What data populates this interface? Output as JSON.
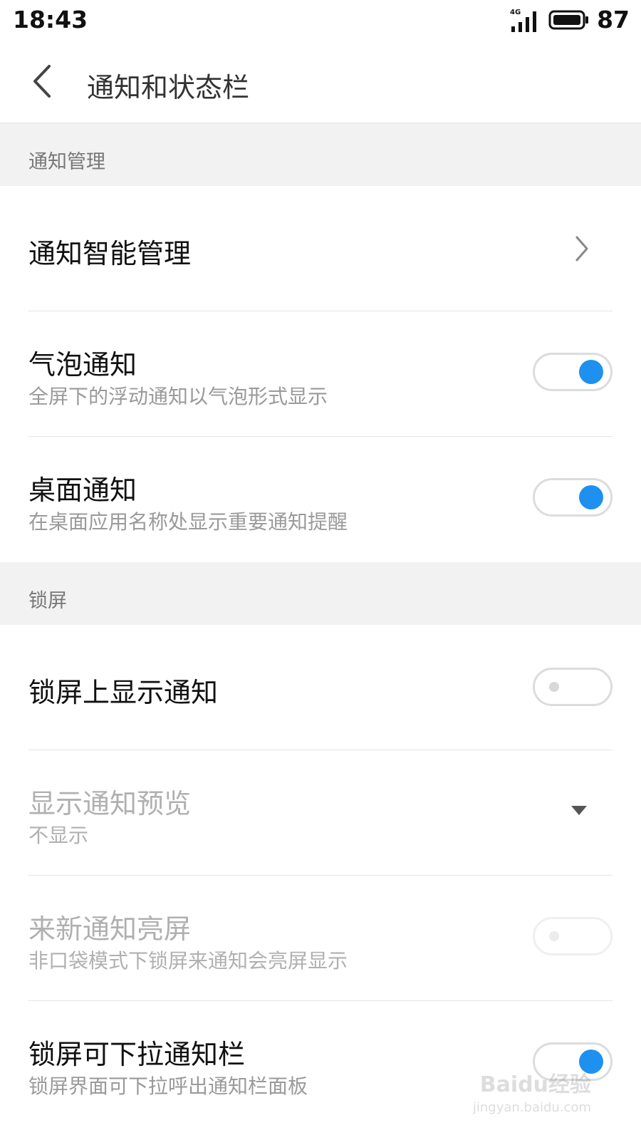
{
  "status_bar": {
    "time": "18:43",
    "network": "4G",
    "battery": "87"
  },
  "header": {
    "title": "通知和状态栏"
  },
  "sections": [
    {
      "title": "通知管理"
    },
    {
      "title": "锁屏"
    }
  ],
  "items": [
    {
      "title": "通知智能管理"
    },
    {
      "title": "气泡通知",
      "subtitle": "全屏下的浮动通知以气泡形式显示",
      "toggle": "on"
    },
    {
      "title": "桌面通知",
      "subtitle": "在桌面应用名称处显示重要通知提醒",
      "toggle": "on"
    },
    {
      "title": "锁屏上显示通知",
      "toggle": "off"
    },
    {
      "title": "显示通知预览",
      "subtitle": "不显示"
    },
    {
      "title": "来新通知亮屏",
      "subtitle": "非口袋模式下锁屏来通知会亮屏显示",
      "toggle": "off-disabled"
    },
    {
      "title": "锁屏可下拉通知栏",
      "subtitle": "锁屏界面可下拉呼出通知栏面板",
      "toggle": "on"
    }
  ],
  "watermark": {
    "brand": "Baidu经验",
    "url": "jingyan.baidu.com"
  },
  "colors": {
    "accent": "#1e90f0",
    "section_bg": "#f2f2f2"
  }
}
